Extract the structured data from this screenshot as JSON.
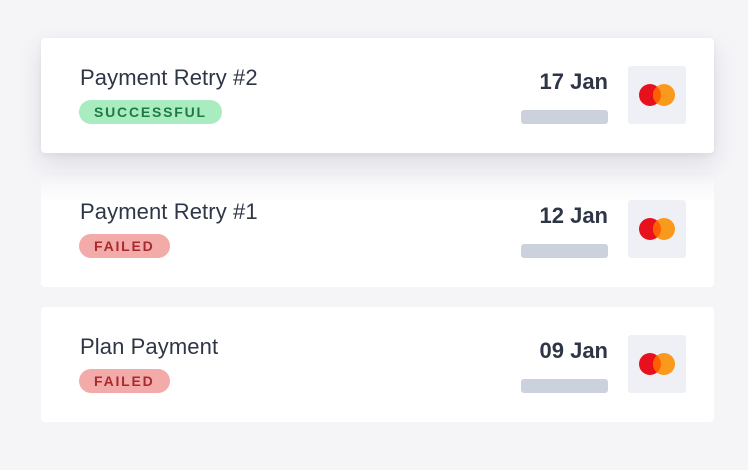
{
  "payments": [
    {
      "title": "Payment Retry #2",
      "status": "SUCCESSFUL",
      "date": "17 Jan",
      "card_icon": "mastercard-icon"
    },
    {
      "title": "Payment Retry #1",
      "status": "FAILED",
      "date": "12 Jan",
      "card_icon": "mastercard-icon"
    },
    {
      "title": "Plan Payment",
      "status": "FAILED",
      "date": "09 Jan",
      "card_icon": "mastercard-icon"
    }
  ],
  "colors": {
    "success_bg": "#a8ecc0",
    "success_text": "#1f7a43",
    "failed_bg": "#f3abaa",
    "failed_text": "#a82a2e",
    "mastercard_red": "#e8101d",
    "mastercard_orange": "#f99a1d"
  }
}
